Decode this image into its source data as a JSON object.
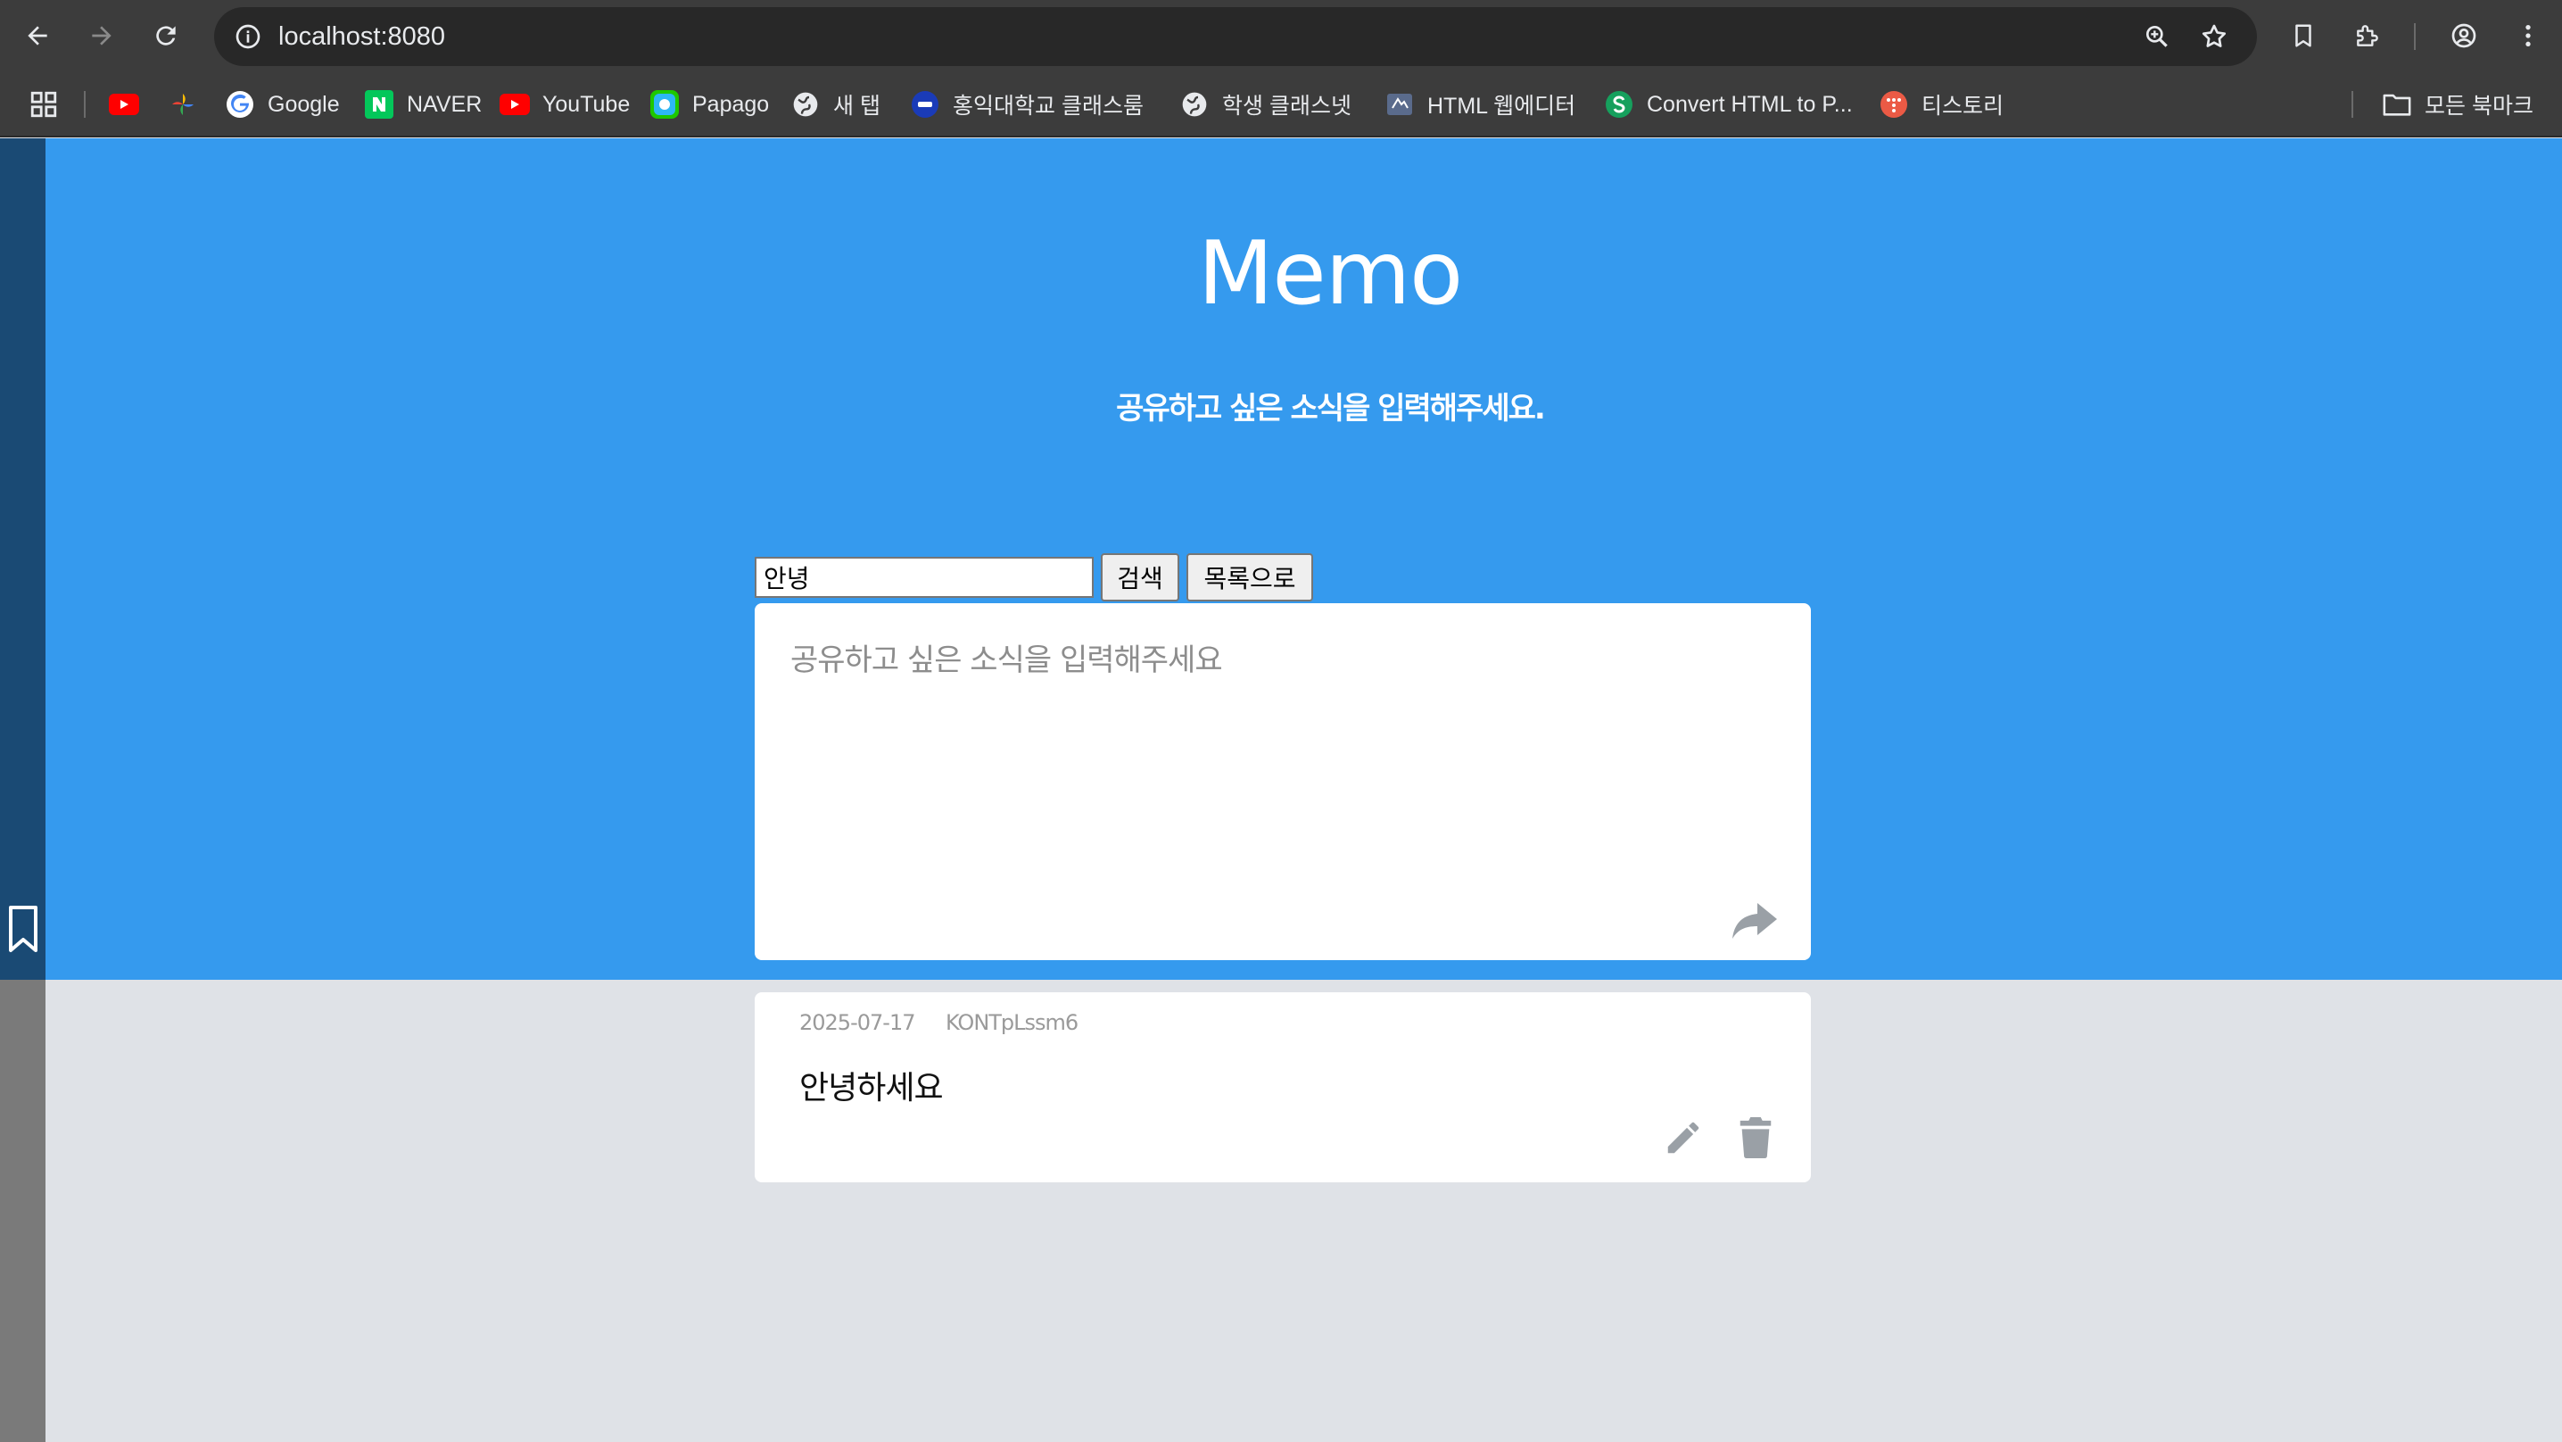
{
  "browser": {
    "url": "localhost:8080",
    "bookmarks": [
      {
        "label": "",
        "icon": "youtube-icon"
      },
      {
        "label": "",
        "icon": "photos-icon"
      },
      {
        "label": "Google",
        "icon": "google-icon"
      },
      {
        "label": "NAVER",
        "icon": "naver-icon"
      },
      {
        "label": "YouTube",
        "icon": "youtube-icon"
      },
      {
        "label": "Papago",
        "icon": "papago-icon"
      },
      {
        "label": "새 탭",
        "icon": "globe-icon"
      },
      {
        "label": "홍익대학교 클래스룸",
        "icon": "classroom-icon"
      },
      {
        "label": "학생 클래스넷",
        "icon": "globe-icon"
      },
      {
        "label": "HTML 웹에디터",
        "icon": "editor-icon"
      },
      {
        "label": "Convert HTML to P...",
        "icon": "convert-icon"
      },
      {
        "label": "티스토리",
        "icon": "tistory-icon"
      }
    ],
    "all_bookmarks_label": "모든 북마크"
  },
  "page": {
    "title": "Memo",
    "subtitle": "공유하고 싶은 소식을 입력해주세요.",
    "search": {
      "value": "안녕"
    },
    "search_button": "검색",
    "list_button": "목록으로",
    "editor_placeholder": "공유하고 싶은 소식을 입력해주세요",
    "memos": [
      {
        "date": "2025-07-17",
        "user": "KONTpLssm6",
        "content": "안녕하세요"
      }
    ]
  },
  "colors": {
    "hero": "#359aee",
    "page_bg": "#dfe2e7",
    "chrome": "#3c3c3c",
    "icon_gray": "#9aa0a6"
  }
}
